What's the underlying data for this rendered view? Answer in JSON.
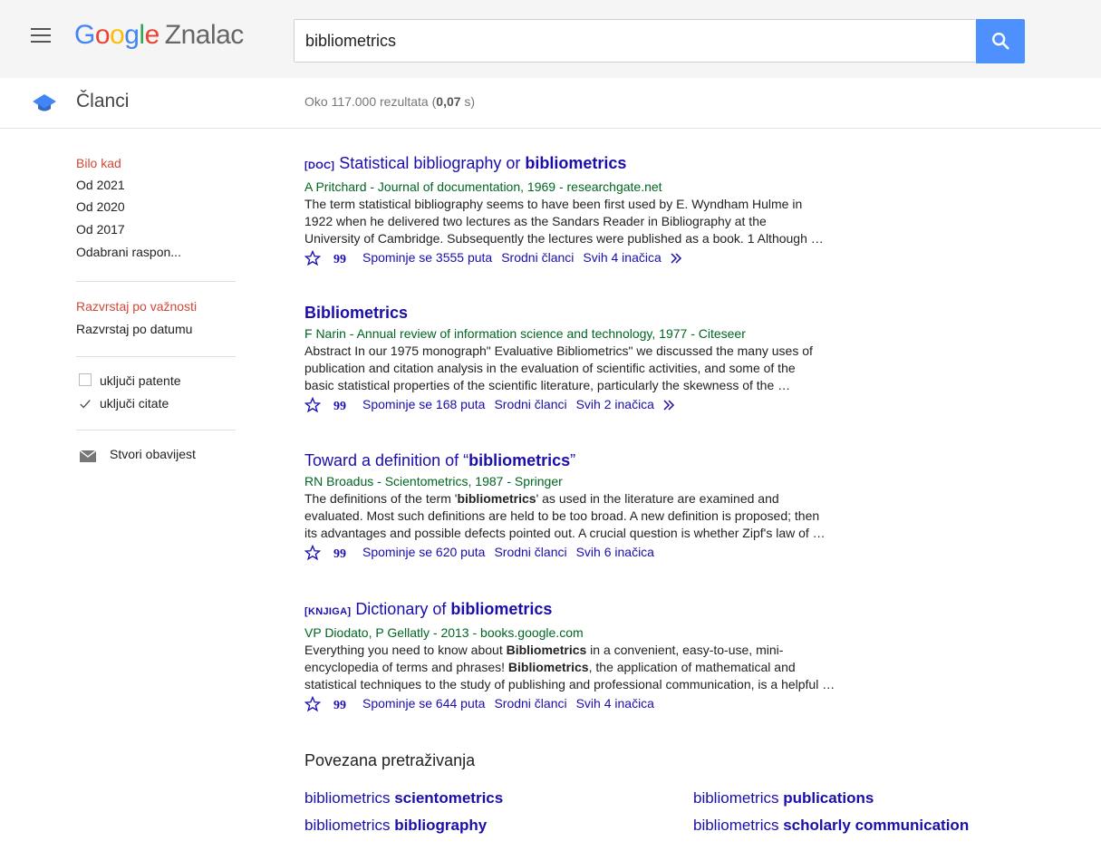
{
  "header": {
    "logo_letters": [
      "G",
      "o",
      "o",
      "g",
      "l",
      "e"
    ],
    "product": "Znalac",
    "search_value": "bibliometrics"
  },
  "subheader": {
    "section": "Članci",
    "stats_prefix": "Oko 117.000 rezultata (",
    "stats_time": "0,07",
    "stats_suffix": " s)"
  },
  "sidebar": {
    "time": [
      "Bilo kad",
      "Od 2021",
      "Od 2020",
      "Od 2017",
      "Odabrani raspon..."
    ],
    "sort": [
      "Razvrstaj po važnosti",
      "Razvrstaj po datumu"
    ],
    "include_patents": "uključi patente",
    "include_citations": "uključi citate",
    "create_alert": "Stvori obavijest"
  },
  "results": [
    {
      "tag": "[DOC]",
      "title_pre": "Statistical bibliography or ",
      "title_bold": "bibliometrics",
      "title_post": "",
      "authors": "A Pritchard - Journal of documentation, 1969 - researchgate.net",
      "snippet": [
        "The term statistical bibliography seems to have been first used by E. Wyndham Hulme in",
        "1922 when he delivered two lectures as the Sandars Reader in Bibliography at the",
        "University of Cambridge. Subsequently the lectures were published as a book. 1 Although …"
      ],
      "cited": "Spominje se 3555 puta",
      "related": "Srodni članci",
      "versions": "Svih 4 inačica",
      "more": true
    },
    {
      "tag": "",
      "title_pre": "",
      "title_bold": "Bibliometrics",
      "title_post": "",
      "authors": "F Narin - Annual review of information science and technology, 1977 - Citeseer",
      "snippet": [
        "Abstract In our 1975 monograph\" Evaluative Bibliometrics\" we discussed the many uses of",
        "publication and citation analysis in the evaluation of scientific activities, and some of the",
        "basic statistical properties of the scientific literature, particularly the skewness of the …"
      ],
      "cited": "Spominje se 168 puta",
      "related": "Srodni članci",
      "versions": "Svih 2 inačica",
      "more": true
    },
    {
      "tag": "",
      "title_pre": "Toward a definition of “",
      "title_bold": "bibliometrics",
      "title_post": "”",
      "authors": "RN Broadus - Scientometrics, 1987 - Springer",
      "snippet_rich": [
        [
          "The definitions of the term '",
          "bibliometrics",
          "' as used in the literature are examined and"
        ],
        [
          "evaluated. Most such definitions are held to be too broad. A new definition is proposed; then",
          "",
          ""
        ],
        [
          "its advantages and possible defects pointed out. A crucial question is whether Zipf's law of …",
          "",
          ""
        ]
      ],
      "cited": "Spominje se 620 puta",
      "related": "Srodni članci",
      "versions": "Svih 6 inačica",
      "more": false
    },
    {
      "tag": "[KNJIGA]",
      "title_pre": "Dictionary of ",
      "title_bold": "bibliometrics",
      "title_post": "",
      "authors": "VP Diodato, P Gellatly - 2013 - books.google.com",
      "snippet_rich": [
        [
          "Everything you need to know about ",
          "Bibliometrics",
          " in a convenient, easy-to-use, mini-"
        ],
        [
          "encyclopedia of terms and phrases! ",
          "Bibliometrics",
          ", the application of mathematical and"
        ],
        [
          "statistical techniques to the study of publishing and professional communication, is a helpful …",
          "",
          ""
        ]
      ],
      "cited": "Spominje se 644 puta",
      "related": "Srodni članci",
      "versions": "Svih 4 inačica",
      "more": false
    }
  ],
  "related_searches": {
    "title": "Povezana pretraživanja",
    "items": [
      {
        "plain": "bibliometrics ",
        "bold": "scientometrics"
      },
      {
        "plain": "bibliometrics ",
        "bold": "publications"
      },
      {
        "plain": "bibliometrics ",
        "bold": "bibliography"
      },
      {
        "plain": "bibliometrics ",
        "bold": "scholarly communication"
      }
    ]
  },
  "colors": {
    "link": "#1a0dab",
    "green": "#006621",
    "red": "#d14836",
    "search_button": "#4d90fe"
  }
}
